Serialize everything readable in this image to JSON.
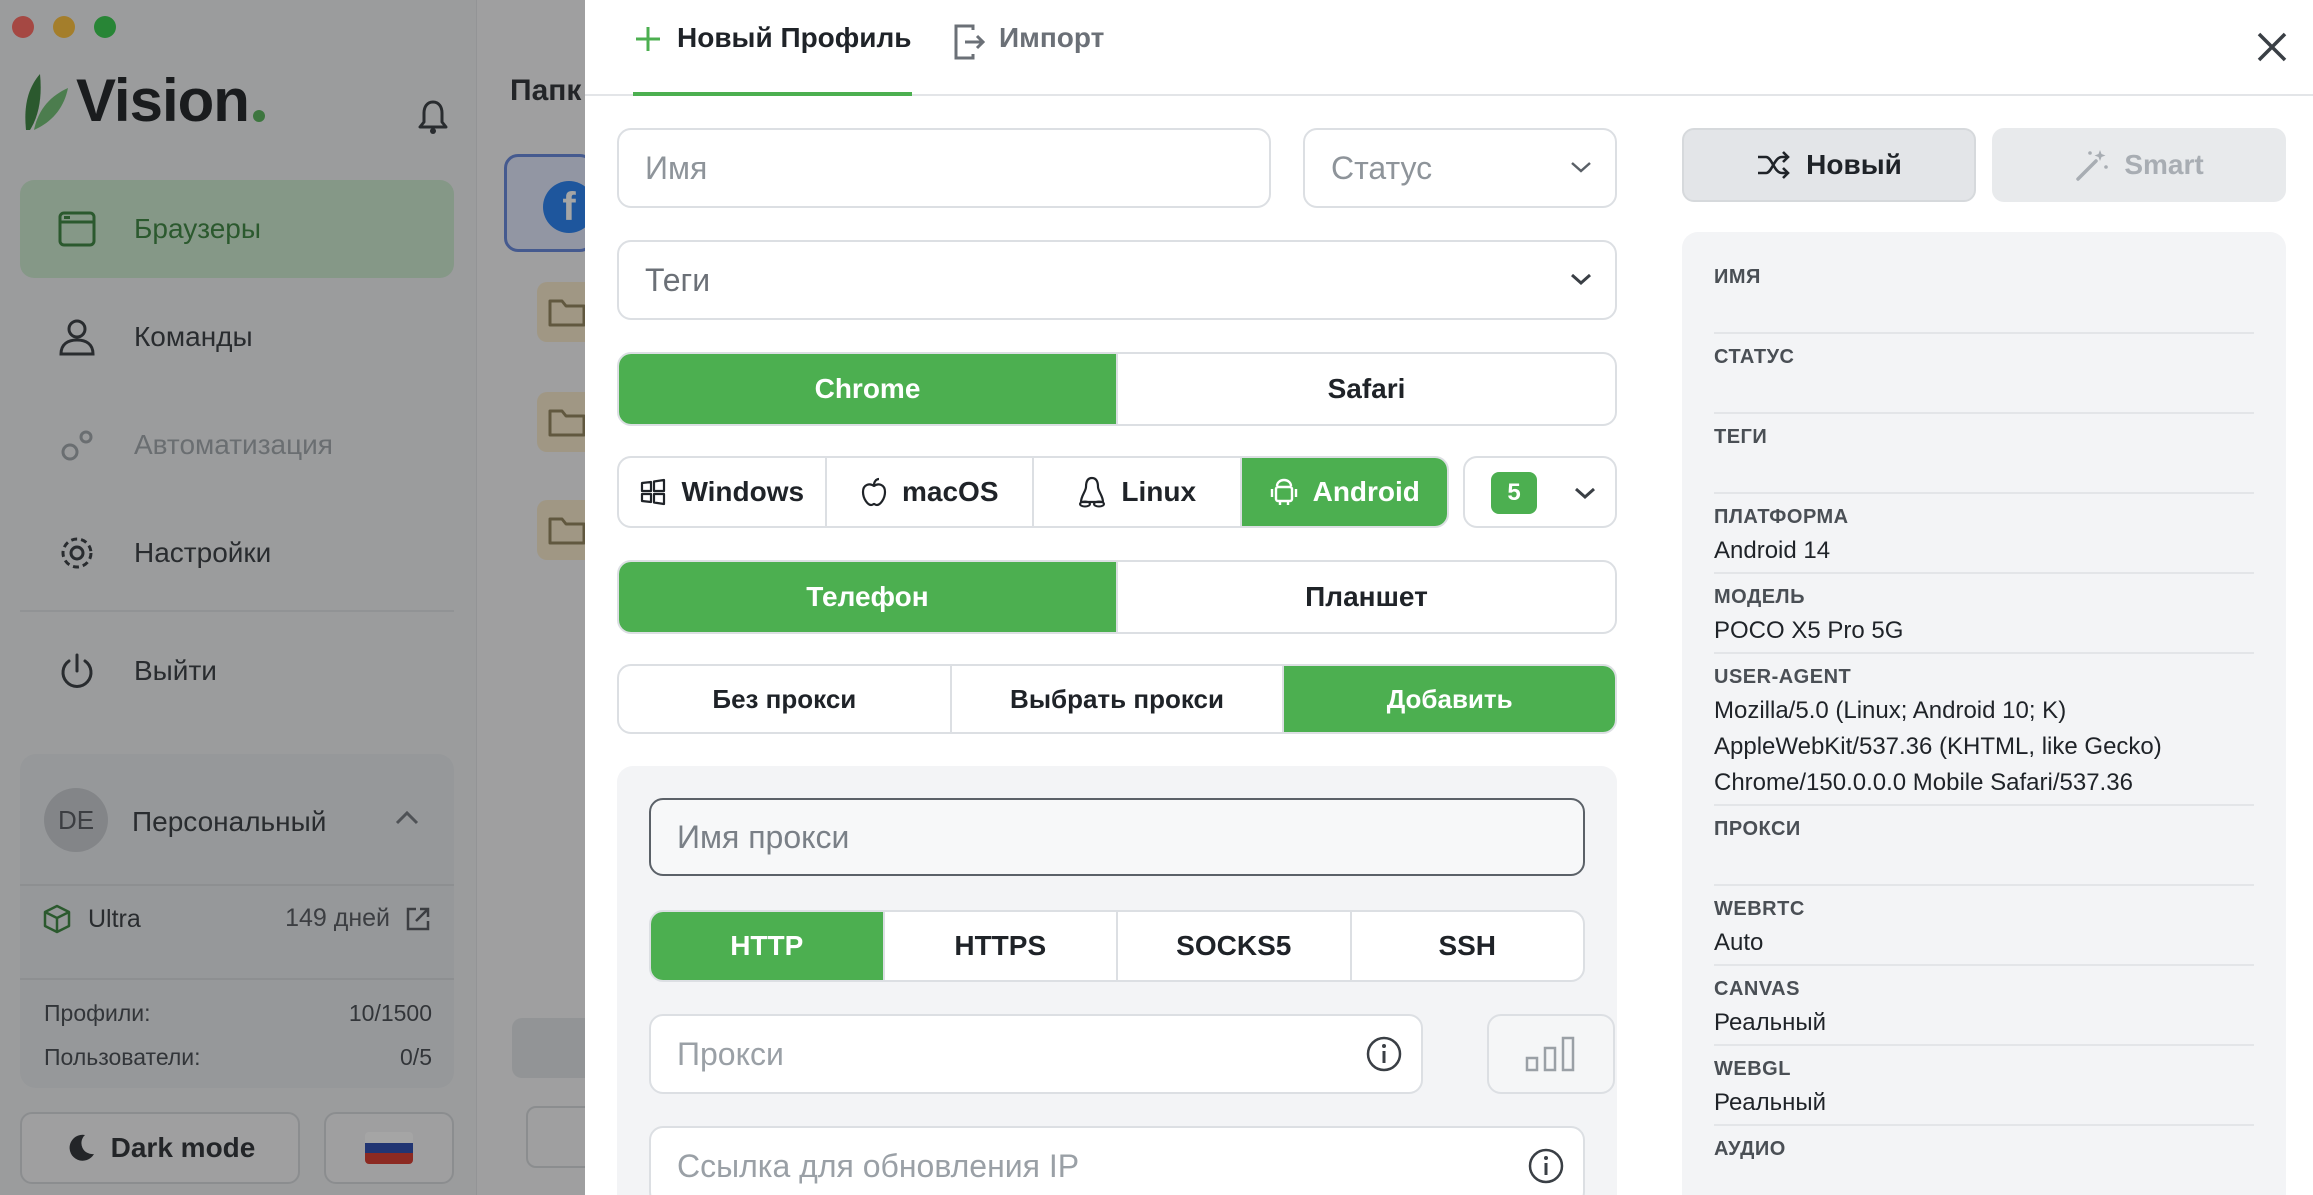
{
  "app": {
    "logo_text": "Vision",
    "nav": [
      {
        "label": "Браузеры",
        "icon": "browser-window-icon",
        "state": "active"
      },
      {
        "label": "Команды",
        "icon": "user-icon",
        "state": "normal"
      },
      {
        "label": "Автоматизация",
        "icon": "gears-icon",
        "state": "disabled"
      },
      {
        "label": "Настройки",
        "icon": "gear-icon",
        "state": "normal"
      },
      {
        "label": "Выйти",
        "icon": "power-icon",
        "state": "normal"
      }
    ],
    "team": {
      "initials": "DE",
      "name": "Персональный",
      "plan": "Ultra",
      "days_left": "149 дней",
      "profiles_label": "Профили:",
      "profiles_value": "10/1500",
      "users_label": "Пользователи:",
      "users_value": "0/5"
    },
    "dark_mode_label": "Dark mode",
    "main_title": "Папк",
    "accent_color": "#4caf50"
  },
  "modal": {
    "tabs": {
      "new_profile": "Новый Профиль",
      "import": "Импорт"
    },
    "form": {
      "name_placeholder": "Имя",
      "status_placeholder": "Статус",
      "tags_placeholder": "Теги",
      "browser_options": [
        {
          "label": "Chrome",
          "selected": true
        },
        {
          "label": "Safari",
          "selected": false
        }
      ],
      "os_options": [
        {
          "label": "Windows",
          "selected": false
        },
        {
          "label": "macOS",
          "selected": false
        },
        {
          "label": "Linux",
          "selected": false
        },
        {
          "label": "Android",
          "selected": true
        }
      ],
      "version_badge": "5",
      "device_options": [
        {
          "label": "Телефон",
          "selected": true
        },
        {
          "label": "Планшет",
          "selected": false
        }
      ],
      "proxy_mode_options": [
        {
          "label": "Без прокси",
          "selected": false
        },
        {
          "label": "Выбрать прокси",
          "selected": false
        },
        {
          "label": "Добавить",
          "selected": true
        }
      ],
      "proxy": {
        "name_placeholder": "Имя прокси",
        "type_options": [
          {
            "label": "HTTP",
            "selected": true
          },
          {
            "label": "HTTPS",
            "selected": false
          },
          {
            "label": "SOCKS5",
            "selected": false
          },
          {
            "label": "SSH",
            "selected": false
          }
        ],
        "proxy_placeholder": "Прокси",
        "refresh_url_placeholder": "Ссылка для обновления IP"
      }
    },
    "generator": {
      "new_label": "Новый",
      "smart_label": "Smart"
    },
    "summary": [
      {
        "label": "ИМЯ",
        "value": ""
      },
      {
        "label": "СТАТУС",
        "value": ""
      },
      {
        "label": "ТЕГИ",
        "value": ""
      },
      {
        "label": "ПЛАТФОРМА",
        "value": "Android 14"
      },
      {
        "label": "МОДЕЛЬ",
        "value": "POCO X5 Pro 5G"
      },
      {
        "label": "USER-AGENT",
        "value": "Mozilla/5.0 (Linux; Android 10; K) AppleWebKit/537.36 (KHTML, like Gecko) Chrome/150.0.0.0 Mobile Safari/537.36"
      },
      {
        "label": "ПРОКСИ",
        "value": ""
      },
      {
        "label": "WEBRTC",
        "value": "Auto"
      },
      {
        "label": "CANVAS",
        "value": "Реальный"
      },
      {
        "label": "WEBGL",
        "value": "Реальный"
      },
      {
        "label": "АУДИО",
        "value": ""
      }
    ]
  }
}
